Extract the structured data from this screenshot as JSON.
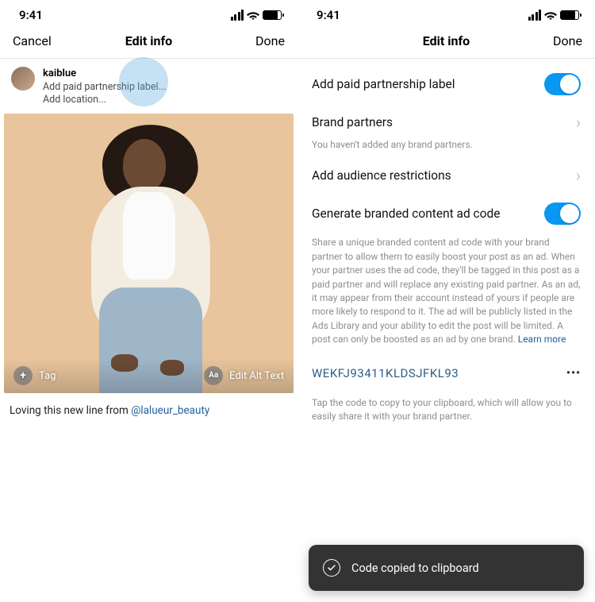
{
  "status": {
    "time": "9:41"
  },
  "nav": {
    "cancel": "Cancel",
    "title": "Edit info",
    "done": "Done"
  },
  "left": {
    "username": "kaiblue",
    "line_paid": "Add paid partnership label...",
    "line_loc": "Add location...",
    "tag_label": "Tag",
    "alt_label": "Edit Alt Text",
    "caption_pre": "Loving this new line from ",
    "caption_mention": "@lalueur_beauty"
  },
  "right": {
    "paid_label": "Add paid partnership label",
    "brand_partners": "Brand partners",
    "brand_hint": "You haven't added any brand partners.",
    "audience": "Add audience restrictions",
    "gen_code": "Generate branded content ad code",
    "gen_desc": "Share a unique branded content ad code with your brand partner to allow them to easily boost your post as an ad. When your partner uses the ad code, they'll be tagged in this post as a paid partner and will replace any existing paid partner. As an ad, it may appear from their account instead of yours if people are more likely to respond to it. The ad will be publicly listed in the Ads Library and your ability to edit the post will be limited. A post can only be boosted as an ad by one brand. ",
    "learn_more": "Learn more",
    "code": "WEKFJ93411KLDSJFKL93",
    "code_hint": "Tap the code to copy to your clipboard, which will allow you to easily share it with your brand partner.",
    "toast": "Code copied to clipboard",
    "toggles": {
      "paid_label_on": true,
      "gen_code_on": true
    }
  }
}
